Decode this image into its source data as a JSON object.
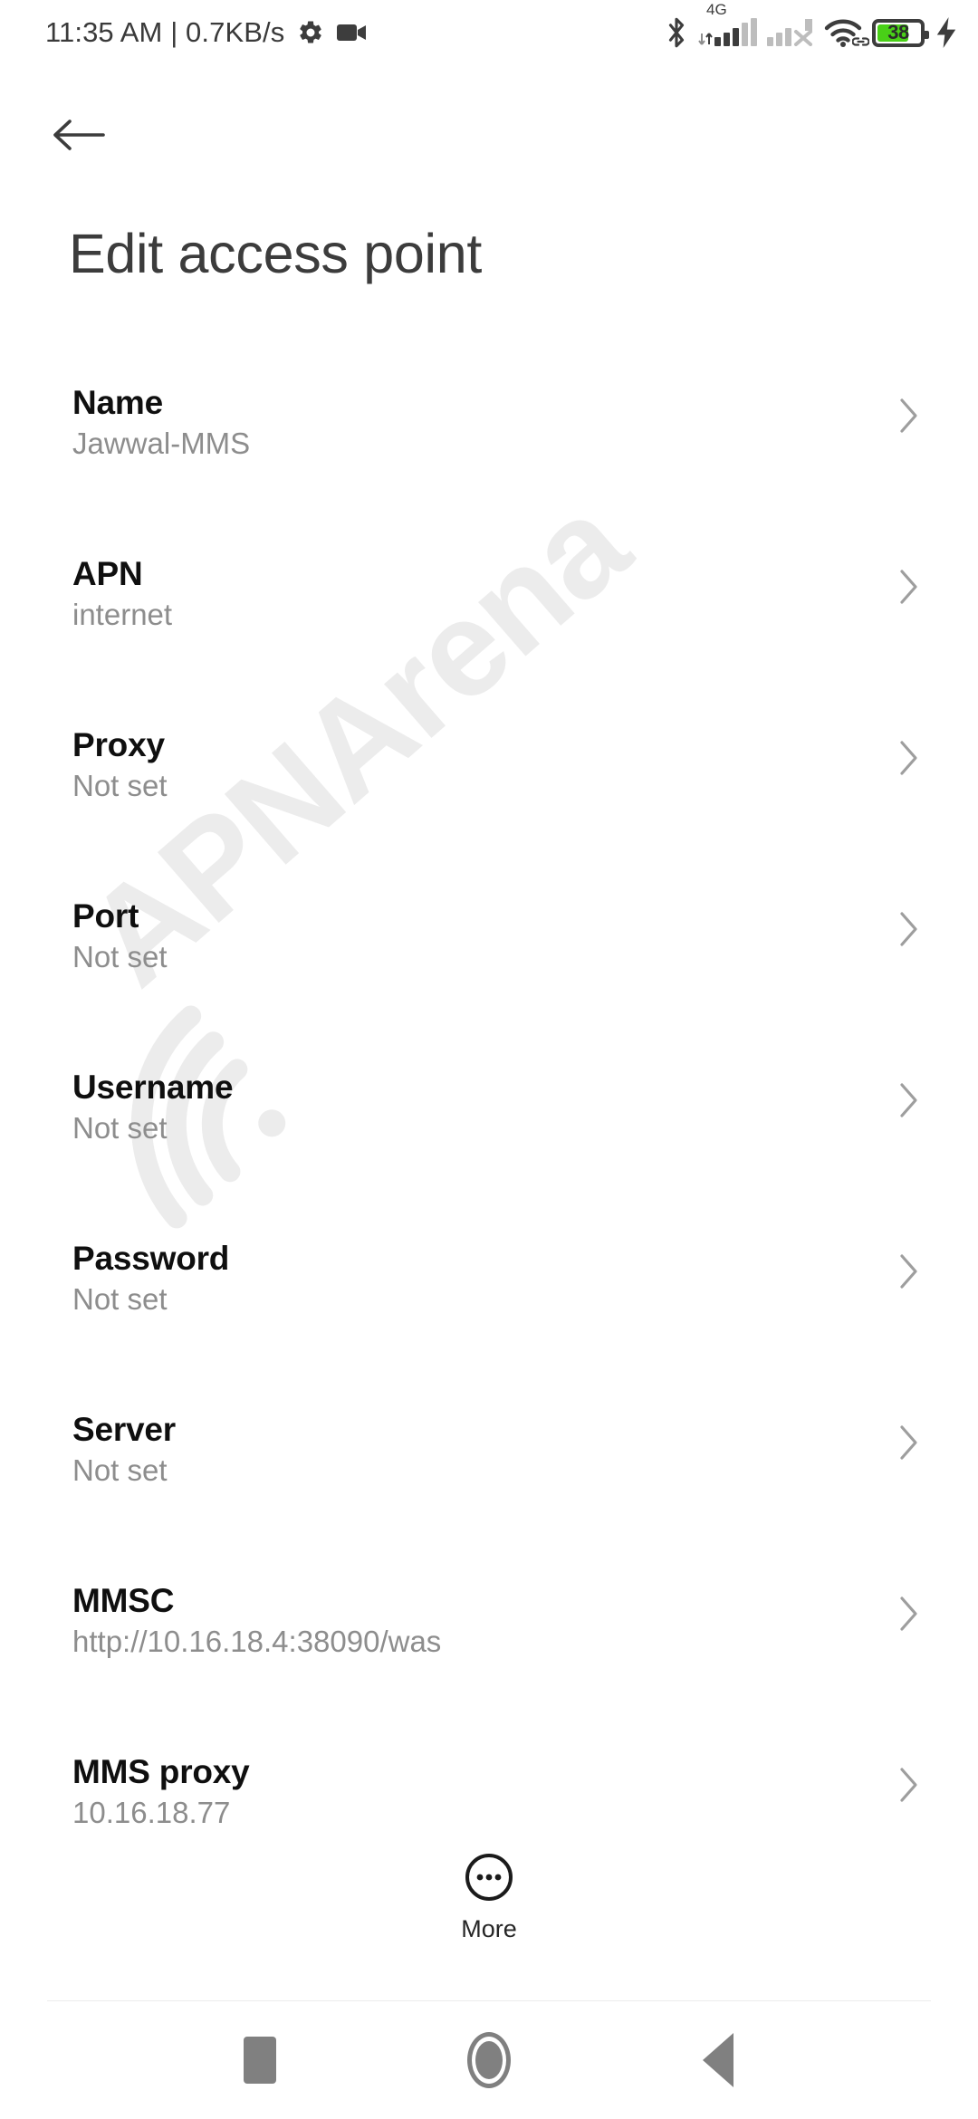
{
  "status_bar": {
    "time": "11:35 AM",
    "separator": "|",
    "network_speed": "0.7KB/s",
    "left_text": "11:35 AM | 0.7KB/s",
    "icons": {
      "gear": "gear-icon",
      "video_recorder": "video-camera-icon",
      "bluetooth": "bluetooth-icon",
      "wifi": "wifi-icon",
      "wifi_link": "link-icon",
      "charging": "charging-bolt-icon",
      "sim2_no_service": "signal-x-icon"
    },
    "sim1_network_type": "4G",
    "battery_percent": "38",
    "battery_color": "#49d017",
    "status_icon_color": "#3d3d3d",
    "inactive_bar_color": "#bdbdbd"
  },
  "appbar": {
    "back_icon": "arrow-left-icon",
    "title": "Edit access point"
  },
  "watermark": {
    "text": "APNArena",
    "color": "#ececec",
    "icon": "wifi-arc-icon"
  },
  "list": {
    "chevron_icon": "chevron-right-icon",
    "chevron_color": "#9e9e9e",
    "items": [
      {
        "label": "Name",
        "value": "Jawwal-MMS"
      },
      {
        "label": "APN",
        "value": "internet"
      },
      {
        "label": "Proxy",
        "value": "Not set"
      },
      {
        "label": "Port",
        "value": "Not set"
      },
      {
        "label": "Username",
        "value": "Not set"
      },
      {
        "label": "Password",
        "value": "Not set"
      },
      {
        "label": "Server",
        "value": "Not set"
      },
      {
        "label": "MMSC",
        "value": "http://10.16.18.4:38090/was"
      },
      {
        "label": "MMS proxy",
        "value": "10.16.18.77"
      }
    ]
  },
  "more_button": {
    "label": "More",
    "icon": "more-circle-icon"
  },
  "nav_bar": {
    "recents_label": "recents-button",
    "home_label": "home-button",
    "back_label": "back-button",
    "color": "#808080"
  }
}
